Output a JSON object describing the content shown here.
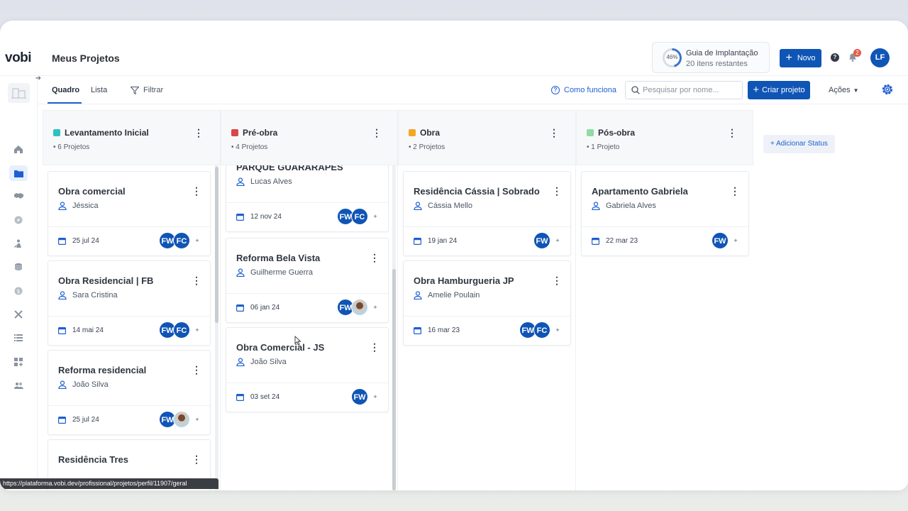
{
  "app": {
    "logo": "vobi",
    "page_title": "Meus Projetos"
  },
  "guide": {
    "percent": "46%",
    "progress": 0.46,
    "title": "Guia de Implantação",
    "subtitle": "20 itens restantes"
  },
  "header": {
    "new_label": "Novo",
    "help_icon": "question-circle-icon",
    "notifications_count": "2",
    "user_initials": "LF"
  },
  "tabs": [
    {
      "label": "Quadro",
      "active": true
    },
    {
      "label": "Lista",
      "active": false
    }
  ],
  "toolbar": {
    "filter_label": "Filtrar",
    "how_it_works": "Como funciona",
    "search_placeholder": "Pesquisar por nome...",
    "create_label": "Criar projeto",
    "actions_label": "Ações"
  },
  "sidebar_icons": [
    "home-icon",
    "folder-icon",
    "handshake-icon",
    "compass-icon",
    "worker-icon",
    "coins-icon",
    "dollar-icon",
    "tools-icon",
    "list-icon",
    "grid-add-icon",
    "team-icon"
  ],
  "colors": {
    "primary": "#0f55b5",
    "levantamento": "#2fc1c0",
    "preobra": "#d9464a",
    "obra": "#f5a623",
    "posobra": "#8fdca4"
  },
  "columns": [
    {
      "name": "Levantamento Inicial",
      "count": "6 Projetos",
      "color": "#2fc1c0"
    },
    {
      "name": "Pré-obra",
      "count": "4 Projetos",
      "color": "#d9464a"
    },
    {
      "name": "Obra",
      "count": "2 Projetos",
      "color": "#f5a623"
    },
    {
      "name": "Pós-obra",
      "count": "1 Projeto",
      "color": "#8fdca4"
    }
  ],
  "cards": {
    "c1": [
      {
        "title": "Obra comercial",
        "person": "Jéssica",
        "date": "25 jul 24",
        "avatars": [
          "FW",
          "FC"
        ],
        "plus": "+"
      },
      {
        "title": "Obra Residencial | FB",
        "person": "Sara Cristina",
        "date": "14 mai 24",
        "avatars": [
          "FW",
          "FC"
        ],
        "plus": "+"
      },
      {
        "title": "Reforma residencial",
        "person": "João Silva",
        "date": "25 jul 24",
        "avatars": [
          "FW"
        ],
        "plus": "+"
      },
      {
        "title": "Residência Tres"
      }
    ],
    "c2": [
      {
        "title": "PARQUE GUARARAPES",
        "person": "Lucas Alves",
        "date": "12 nov 24",
        "avatars": [
          "FW",
          "FC"
        ],
        "plus": "+"
      },
      {
        "title": "Reforma Bela Vista",
        "person": "Guilherme Guerra",
        "date": "06 jan 24",
        "avatars": [
          "FW"
        ],
        "plus": "+"
      },
      {
        "title": "Obra Comercial - JS",
        "person": "João Silva",
        "date": "03 set 24",
        "avatars": [
          "FW"
        ],
        "plus": "+"
      }
    ],
    "c3": [
      {
        "title": "Residência Cássia | Sobrado",
        "person": "Cássia Mello",
        "date": "19 jan 24",
        "avatars": [
          "FW"
        ],
        "plus": "+"
      },
      {
        "title": "Obra Hamburgueria JP",
        "person": "Amelie Poulain",
        "date": "16 mar 23",
        "avatars": [
          "FW",
          "FC"
        ],
        "plus": "+"
      }
    ],
    "c4": [
      {
        "title": "Apartamento Gabriela",
        "person": "Gabriela Alves",
        "date": "22 mar 23",
        "avatars": [
          "FW"
        ],
        "plus": "+"
      }
    ]
  },
  "add_status_label": "+ Adicionar Status",
  "status_url": "https://plataforma.vobi.dev/profissional/projetos/perfil/11907/geral"
}
